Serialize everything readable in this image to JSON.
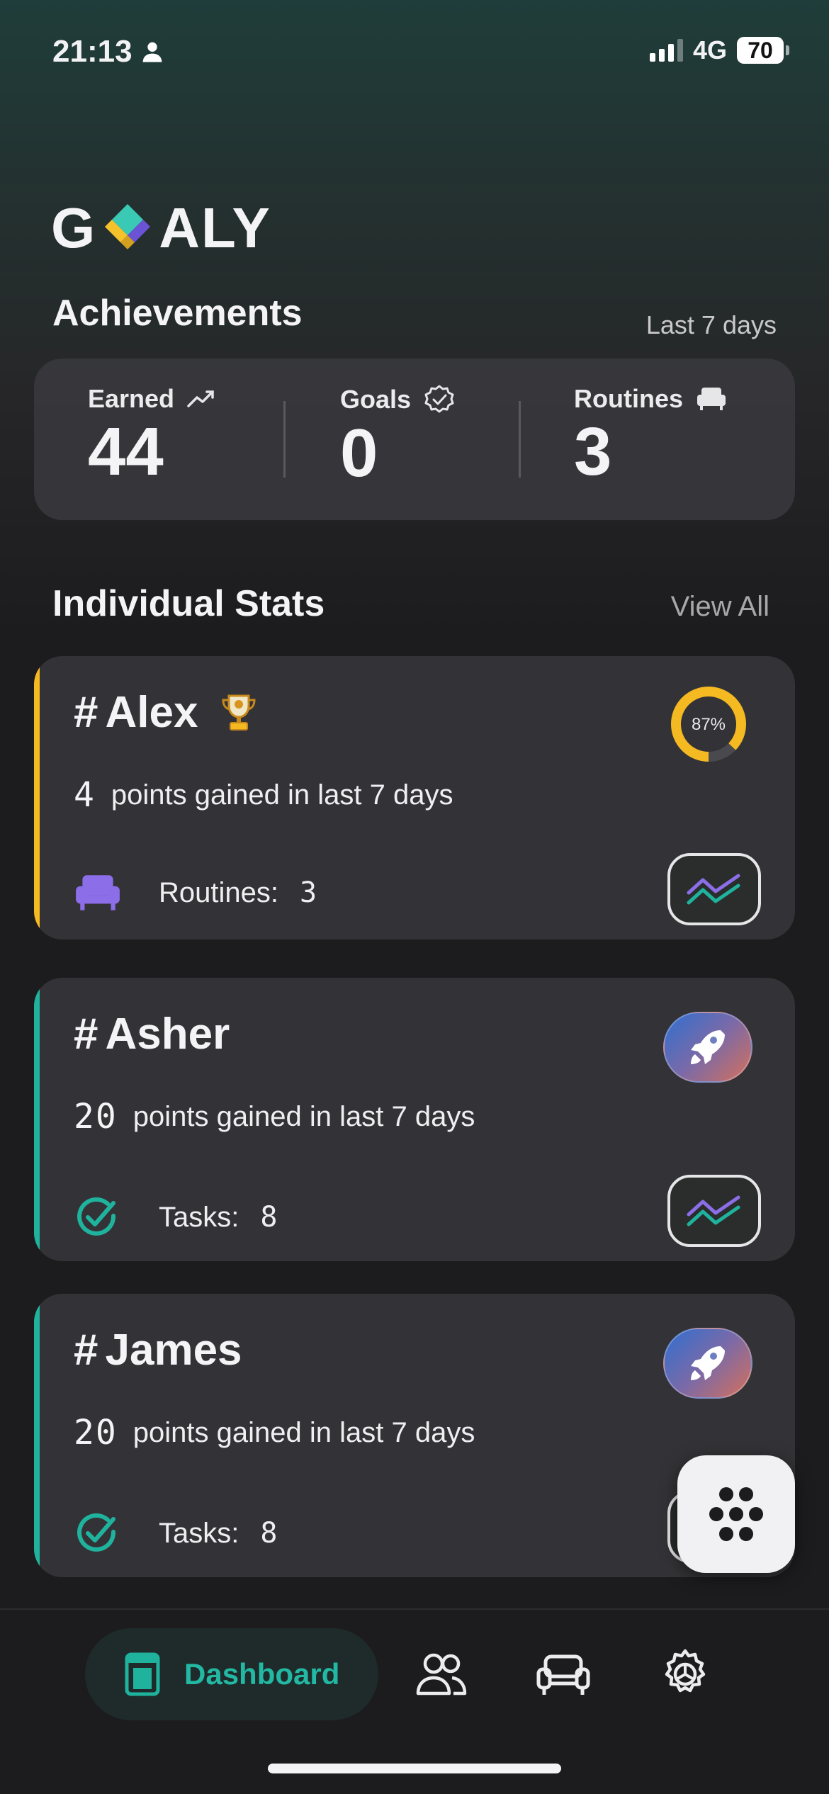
{
  "status_bar": {
    "time": "21:13",
    "network": "4G",
    "battery": "70"
  },
  "app": {
    "logo_left": "G",
    "logo_right": "ALY"
  },
  "achievements": {
    "title": "Achievements",
    "period": "Last 7 days",
    "stats": [
      {
        "label": "Earned",
        "value": "44",
        "icon": "trend-up-icon"
      },
      {
        "label": "Goals",
        "value": "0",
        "icon": "verified-badge-icon"
      },
      {
        "label": "Routines",
        "value": "3",
        "icon": "sofa-icon"
      }
    ]
  },
  "individual_stats": {
    "title": "Individual Stats",
    "view_all": "View All",
    "cards": [
      {
        "hash": "#",
        "name": "Alex",
        "badge_icon": "trophy-icon",
        "progress_percent": 87,
        "progress_label": "87%",
        "points": "4",
        "points_text": "points gained in last 7 days",
        "meta_label": "Routines:",
        "meta_value": "3",
        "meta_icon": "sofa-icon",
        "accent": "#f5b921"
      },
      {
        "hash": "#",
        "name": "Asher",
        "badge_icon": "rocket-icon",
        "points": "20",
        "points_text": "points gained in last 7 days",
        "meta_label": "Tasks:",
        "meta_value": "8",
        "meta_icon": "check-circle-icon",
        "accent": "#1fb39e"
      },
      {
        "hash": "#",
        "name": "James",
        "badge_icon": "rocket-icon",
        "points": "20",
        "points_text": "points gained in last 7 days",
        "meta_label": "Tasks:",
        "meta_value": "8",
        "meta_icon": "check-circle-icon",
        "accent": "#1fb39e"
      }
    ]
  },
  "bottom_nav": {
    "items": [
      {
        "label": "Dashboard",
        "icon": "dashboard-icon",
        "active": true
      },
      {
        "label": "",
        "icon": "people-icon"
      },
      {
        "label": "",
        "icon": "sofa-icon"
      },
      {
        "label": "",
        "icon": "settings-icon"
      }
    ]
  },
  "colors": {
    "teal": "#1fb39e",
    "yellow": "#f5b921",
    "purple": "#8b6ee8"
  }
}
